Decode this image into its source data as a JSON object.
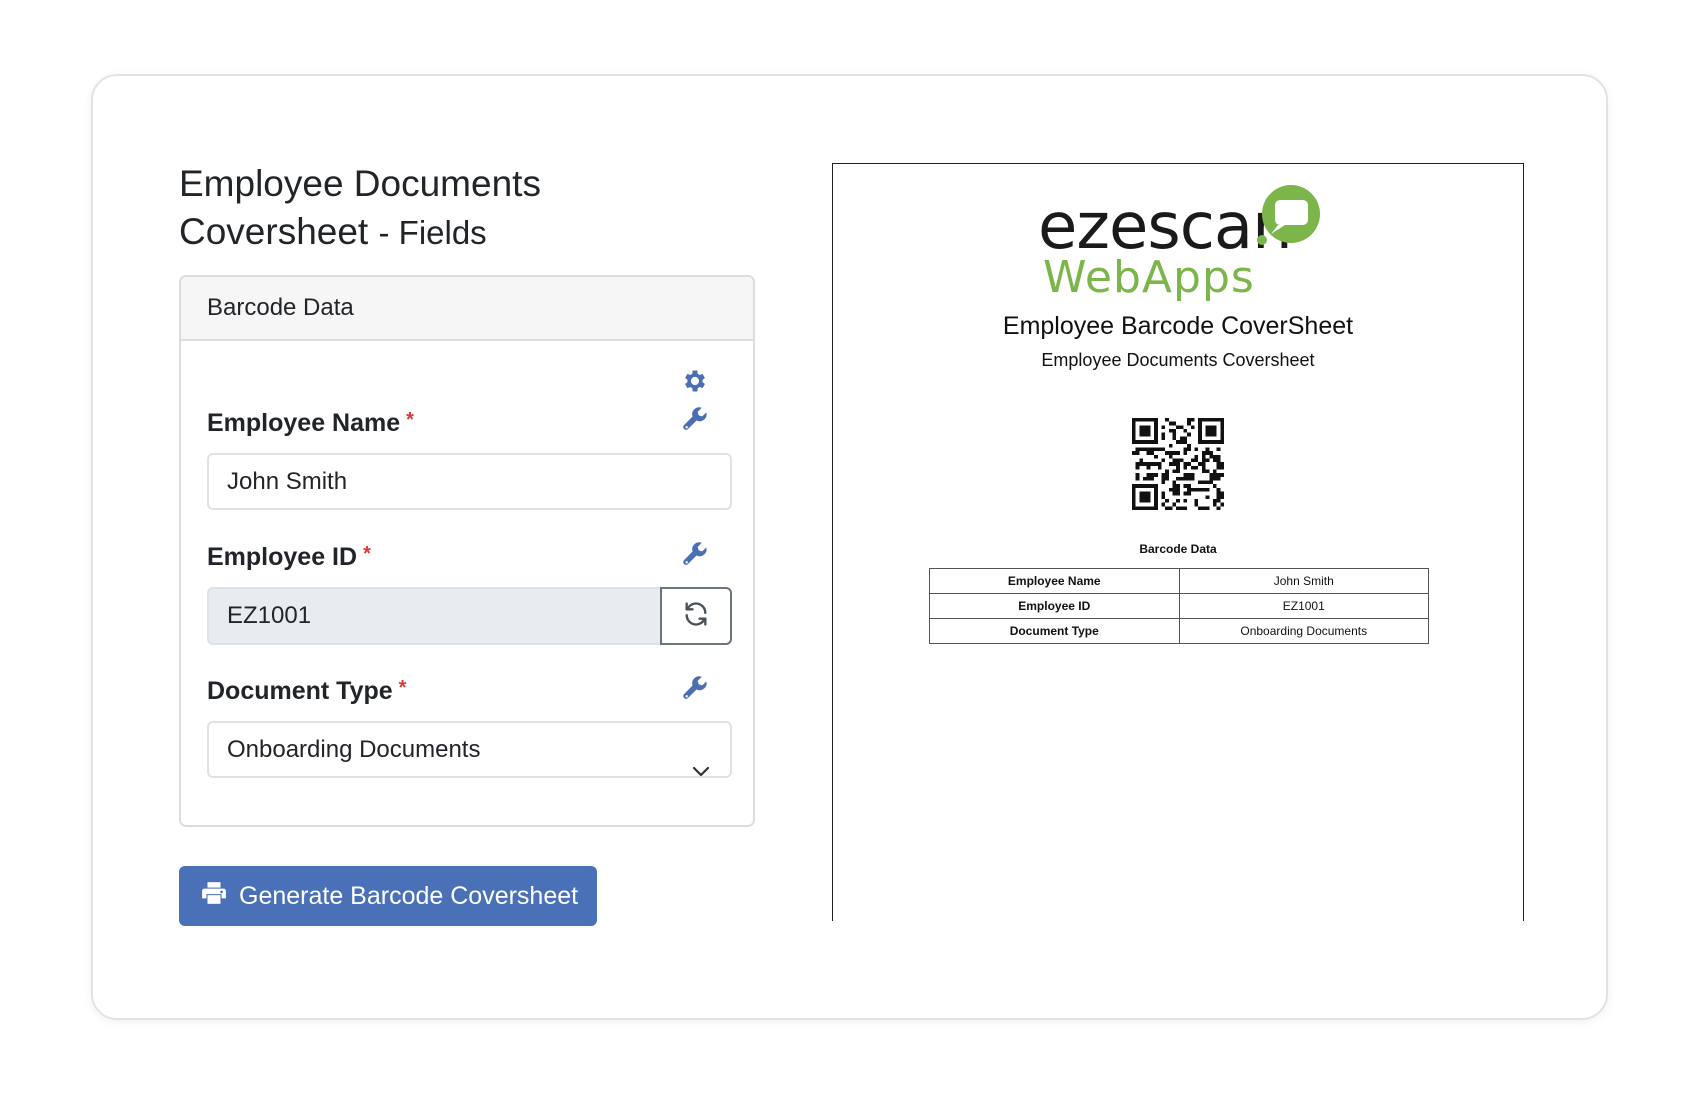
{
  "page": {
    "title_main": "Employee Documents Coversheet",
    "title_suffix": "- Fields"
  },
  "panel": {
    "header": "Barcode Data",
    "fields": {
      "employee_name": {
        "label": "Employee Name",
        "required": "*",
        "value": "John Smith"
      },
      "employee_id": {
        "label": "Employee ID",
        "required": "*",
        "value": "EZ1001"
      },
      "document_type": {
        "label": "Document Type",
        "required": "*",
        "value": "Onboarding Documents"
      }
    }
  },
  "generate_button": {
    "label": "Generate Barcode Coversheet"
  },
  "preview": {
    "logo_top": "ezescan",
    "logo_bottom": "WebApps",
    "title": "Employee Barcode CoverSheet",
    "subtitle": "Employee Documents Coversheet",
    "barcode_heading": "Barcode Data",
    "rows": [
      {
        "key": "Employee Name",
        "value": "John Smith"
      },
      {
        "key": "Employee ID",
        "value": "EZ1001"
      },
      {
        "key": "Document Type",
        "value": "Onboarding Documents"
      }
    ]
  },
  "colors": {
    "accent": "#4a70b7",
    "icon": "#4a6fb5",
    "required": "#d9383a",
    "logo_green": "#7cb54a"
  },
  "icons": [
    "gear-icon",
    "wrench-icon",
    "refresh-icon",
    "chevron-down-icon",
    "printer-icon",
    "chat-bubble-icon",
    "qr-code-icon"
  ]
}
